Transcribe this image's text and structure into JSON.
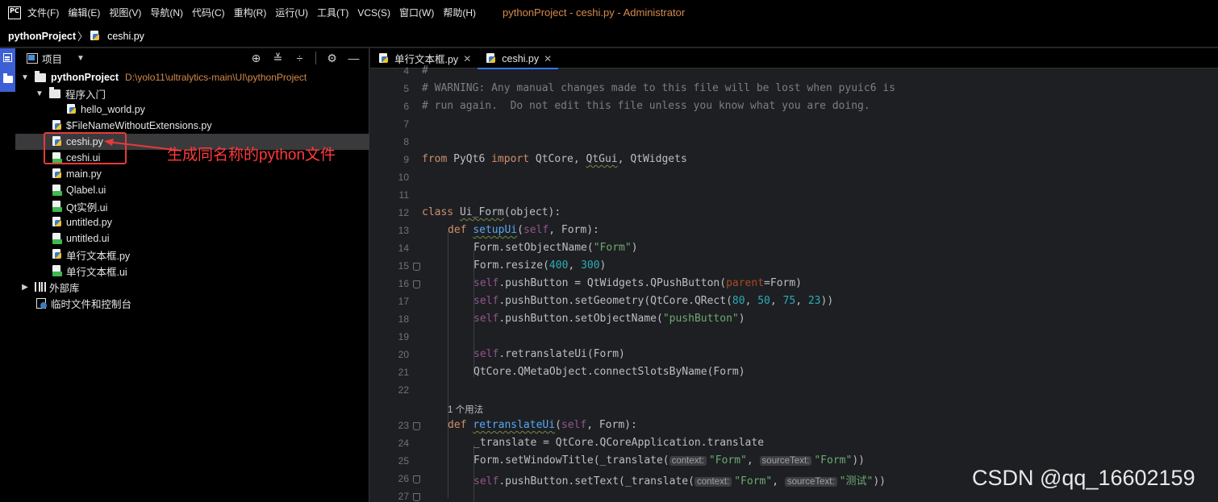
{
  "menubar": {
    "logo": "PC",
    "items": [
      "文件(F)",
      "编辑(E)",
      "视图(V)",
      "导航(N)",
      "代码(C)",
      "重构(R)",
      "运行(U)",
      "工具(T)",
      "VCS(S)",
      "窗口(W)",
      "帮助(H)"
    ],
    "window_title": "pythonProject - ceshi.py - Administrator"
  },
  "breadcrumb": {
    "project": "pythonProject",
    "file": "ceshi.py"
  },
  "project_panel": {
    "title": "项目",
    "tree": [
      {
        "label": "pythonProject",
        "path": "D:\\yolo11\\ultralytics-main\\UI\\pythonProject",
        "type": "folder",
        "expanded": true
      },
      {
        "label": "程序入门",
        "type": "folder",
        "expanded": true
      },
      {
        "label": "hello_world.py",
        "type": "py"
      },
      {
        "label": "$FileNameWithoutExtensions.py",
        "type": "py"
      },
      {
        "label": "ceshi.py",
        "type": "py",
        "selected": true
      },
      {
        "label": "ceshi.ui",
        "type": "ui"
      },
      {
        "label": "main.py",
        "type": "py"
      },
      {
        "label": "Qlabel.ui",
        "type": "ui"
      },
      {
        "label": "Qt实例.ui",
        "type": "ui"
      },
      {
        "label": "untitled.py",
        "type": "py"
      },
      {
        "label": "untitled.ui",
        "type": "ui"
      },
      {
        "label": "单行文本框.py",
        "type": "py"
      },
      {
        "label": "单行文本框.ui",
        "type": "ui"
      },
      {
        "label": "外部库",
        "type": "lib"
      },
      {
        "label": "临时文件和控制台",
        "type": "scratch"
      }
    ],
    "annotation": "生成同名称的python文件"
  },
  "editor": {
    "tabs": [
      {
        "label": "单行文本框.py",
        "active": false
      },
      {
        "label": "ceshi.py",
        "active": true
      }
    ],
    "line_numbers": [
      "4",
      "5",
      "6",
      "7",
      "8",
      "9",
      "10",
      "11",
      "12",
      "13",
      "14",
      "15",
      "16",
      "17",
      "18",
      "19",
      "20",
      "21",
      "22",
      "23",
      "24",
      "25",
      "26",
      "27"
    ],
    "code": {
      "l4": "#",
      "l5": "# WARNING: Any manual changes made to this file will be lost when pyuic6 is",
      "l6": "# run again.  Do not edit this file unless you know what you are doing.",
      "l9_from": "from",
      "l9_mod": "PyQt6",
      "l9_import": "import",
      "l9_names_a": "QtCore, ",
      "l9_names_b": "QtGui",
      "l9_names_c": ", QtWidgets",
      "l12_class": "class",
      "l12_name": "Ui_Form",
      "l12_rest": "(object):",
      "l13_def": "def",
      "l13_name": "setupUi",
      "l13_self": "self",
      "l13_rest": ", Form):",
      "l14_a": "Form.setObjectName(",
      "l14_str": "\"Form\"",
      "l14_b": ")",
      "l15_a": "Form.resize(",
      "l15_n1": "400",
      "l15_sep": ", ",
      "l15_n2": "300",
      "l15_b": ")",
      "l16_self": "self",
      "l16_a": ".pushButton = QtWidgets.QPushButton(",
      "l16_kw": "parent",
      "l16_b": "=Form)",
      "l17_self": "self",
      "l17_a": ".pushButton.setGeometry(QtCore.QRect(",
      "l17_n1": "80",
      "l17_n2": "50",
      "l17_n3": "75",
      "l17_n4": "23",
      "l17_b": "))",
      "l18_self": "self",
      "l18_a": ".pushButton.setObjectName(",
      "l18_str": "\"pushButton\"",
      "l18_b": ")",
      "l20_self": "self",
      "l20_a": ".retranslateUi(Form)",
      "l21": "QtCore.QMetaObject.connectSlotsByName(Form)",
      "usages": "1 个用法",
      "l23_def": "def",
      "l23_name": "retranslateUi",
      "l23_self": "self",
      "l23_rest": ", Form):",
      "l24": "_translate = QtCore.QCoreApplication.translate",
      "l25_a": "Form.setWindowTitle(_translate(",
      "l25_hint1": "context:",
      "l25_s1": "\"Form\"",
      "l25_hint2": "sourceText:",
      "l25_s2": "\"Form\"",
      "l25_b": "))",
      "l26_self": "self",
      "l26_a": ".pushButton.setText(_translate(",
      "l26_hint1": "context:",
      "l26_s1": "\"Form\"",
      "l26_hint2": "sourceText:",
      "l26_s2": "\"测试\"",
      "l26_b": "))"
    }
  },
  "watermark": "CSDN @qq_16602159",
  "colors": {
    "accent": "#3574f0",
    "annotation": "#e53a3a",
    "path": "#d58a4b"
  }
}
